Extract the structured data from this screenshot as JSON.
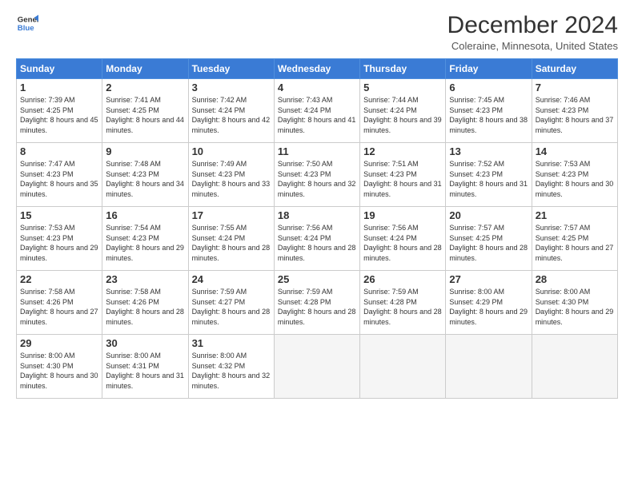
{
  "header": {
    "logo_line1": "General",
    "logo_line2": "Blue",
    "title": "December 2024",
    "subtitle": "Coleraine, Minnesota, United States"
  },
  "calendar": {
    "days_of_week": [
      "Sunday",
      "Monday",
      "Tuesday",
      "Wednesday",
      "Thursday",
      "Friday",
      "Saturday"
    ],
    "weeks": [
      [
        {
          "day": "1",
          "sunrise": "7:39 AM",
          "sunset": "4:25 PM",
          "daylight": "8 hours and 45 minutes."
        },
        {
          "day": "2",
          "sunrise": "7:41 AM",
          "sunset": "4:25 PM",
          "daylight": "8 hours and 44 minutes."
        },
        {
          "day": "3",
          "sunrise": "7:42 AM",
          "sunset": "4:24 PM",
          "daylight": "8 hours and 42 minutes."
        },
        {
          "day": "4",
          "sunrise": "7:43 AM",
          "sunset": "4:24 PM",
          "daylight": "8 hours and 41 minutes."
        },
        {
          "day": "5",
          "sunrise": "7:44 AM",
          "sunset": "4:24 PM",
          "daylight": "8 hours and 39 minutes."
        },
        {
          "day": "6",
          "sunrise": "7:45 AM",
          "sunset": "4:23 PM",
          "daylight": "8 hours and 38 minutes."
        },
        {
          "day": "7",
          "sunrise": "7:46 AM",
          "sunset": "4:23 PM",
          "daylight": "8 hours and 37 minutes."
        }
      ],
      [
        {
          "day": "8",
          "sunrise": "7:47 AM",
          "sunset": "4:23 PM",
          "daylight": "8 hours and 35 minutes."
        },
        {
          "day": "9",
          "sunrise": "7:48 AM",
          "sunset": "4:23 PM",
          "daylight": "8 hours and 34 minutes."
        },
        {
          "day": "10",
          "sunrise": "7:49 AM",
          "sunset": "4:23 PM",
          "daylight": "8 hours and 33 minutes."
        },
        {
          "day": "11",
          "sunrise": "7:50 AM",
          "sunset": "4:23 PM",
          "daylight": "8 hours and 32 minutes."
        },
        {
          "day": "12",
          "sunrise": "7:51 AM",
          "sunset": "4:23 PM",
          "daylight": "8 hours and 31 minutes."
        },
        {
          "day": "13",
          "sunrise": "7:52 AM",
          "sunset": "4:23 PM",
          "daylight": "8 hours and 31 minutes."
        },
        {
          "day": "14",
          "sunrise": "7:53 AM",
          "sunset": "4:23 PM",
          "daylight": "8 hours and 30 minutes."
        }
      ],
      [
        {
          "day": "15",
          "sunrise": "7:53 AM",
          "sunset": "4:23 PM",
          "daylight": "8 hours and 29 minutes."
        },
        {
          "day": "16",
          "sunrise": "7:54 AM",
          "sunset": "4:23 PM",
          "daylight": "8 hours and 29 minutes."
        },
        {
          "day": "17",
          "sunrise": "7:55 AM",
          "sunset": "4:24 PM",
          "daylight": "8 hours and 28 minutes."
        },
        {
          "day": "18",
          "sunrise": "7:56 AM",
          "sunset": "4:24 PM",
          "daylight": "8 hours and 28 minutes."
        },
        {
          "day": "19",
          "sunrise": "7:56 AM",
          "sunset": "4:24 PM",
          "daylight": "8 hours and 28 minutes."
        },
        {
          "day": "20",
          "sunrise": "7:57 AM",
          "sunset": "4:25 PM",
          "daylight": "8 hours and 28 minutes."
        },
        {
          "day": "21",
          "sunrise": "7:57 AM",
          "sunset": "4:25 PM",
          "daylight": "8 hours and 27 minutes."
        }
      ],
      [
        {
          "day": "22",
          "sunrise": "7:58 AM",
          "sunset": "4:26 PM",
          "daylight": "8 hours and 27 minutes."
        },
        {
          "day": "23",
          "sunrise": "7:58 AM",
          "sunset": "4:26 PM",
          "daylight": "8 hours and 28 minutes."
        },
        {
          "day": "24",
          "sunrise": "7:59 AM",
          "sunset": "4:27 PM",
          "daylight": "8 hours and 28 minutes."
        },
        {
          "day": "25",
          "sunrise": "7:59 AM",
          "sunset": "4:28 PM",
          "daylight": "8 hours and 28 minutes."
        },
        {
          "day": "26",
          "sunrise": "7:59 AM",
          "sunset": "4:28 PM",
          "daylight": "8 hours and 28 minutes."
        },
        {
          "day": "27",
          "sunrise": "8:00 AM",
          "sunset": "4:29 PM",
          "daylight": "8 hours and 29 minutes."
        },
        {
          "day": "28",
          "sunrise": "8:00 AM",
          "sunset": "4:30 PM",
          "daylight": "8 hours and 29 minutes."
        }
      ],
      [
        {
          "day": "29",
          "sunrise": "8:00 AM",
          "sunset": "4:30 PM",
          "daylight": "8 hours and 30 minutes."
        },
        {
          "day": "30",
          "sunrise": "8:00 AM",
          "sunset": "4:31 PM",
          "daylight": "8 hours and 31 minutes."
        },
        {
          "day": "31",
          "sunrise": "8:00 AM",
          "sunset": "4:32 PM",
          "daylight": "8 hours and 32 minutes."
        },
        null,
        null,
        null,
        null
      ]
    ]
  }
}
